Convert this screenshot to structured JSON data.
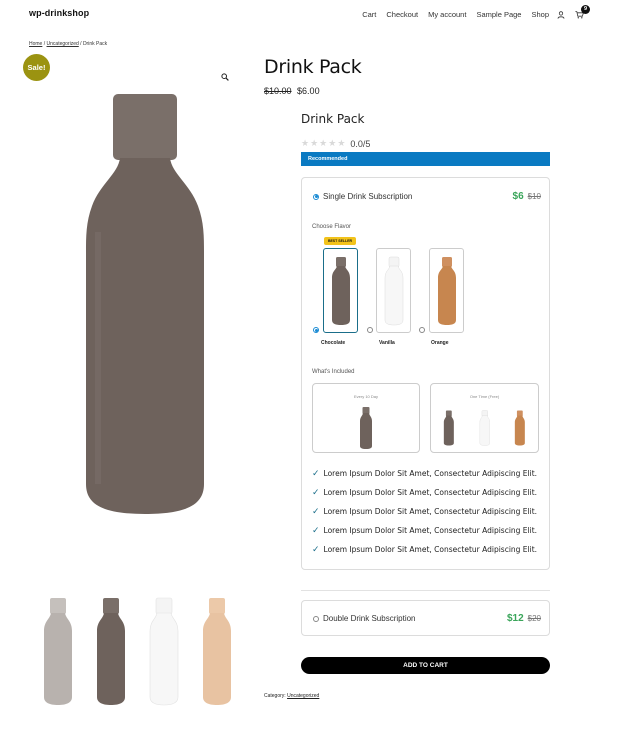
{
  "site": {
    "title": "wp-drinkshop"
  },
  "nav": {
    "items": [
      "Cart",
      "Checkout",
      "My account",
      "Sample Page",
      "Shop"
    ],
    "cart_count": "9"
  },
  "breadcrumb": {
    "home": "Home",
    "sep": " / ",
    "category": "Uncategorized",
    "current": "Drink Pack"
  },
  "gallery": {
    "sale_label": "Sale!"
  },
  "product": {
    "title": "Drink Pack",
    "old_price": "$10.00",
    "price": "$6.00",
    "sub_title": "Drink Pack",
    "rating": "0.0/5",
    "recommended": "Recommended"
  },
  "subscription": {
    "single": {
      "label": "Single Drink Subscription",
      "price": "$6",
      "old_price": "$10"
    },
    "double": {
      "label": "Double Drink Subscription",
      "price": "$12",
      "old_price": "$20"
    },
    "choose_flavor": "Choose Flavor",
    "best_seller": "BEST SELLER",
    "flavors": [
      {
        "name": "Chocolate",
        "selected": true,
        "color": "#6e625c"
      },
      {
        "name": "Vanilla",
        "selected": false,
        "color": "#f2f2f2"
      },
      {
        "name": "Orange",
        "selected": false,
        "color": "#c7864f"
      }
    ],
    "whats_included": "What's Included",
    "included": [
      {
        "label": "Every 10 Day"
      },
      {
        "label": "One Time (Free)"
      }
    ],
    "benefits": [
      "Lorem Ipsum Dolor Sit Amet, Consectetur Adipiscing Elit.",
      "Lorem Ipsum Dolor Sit Amet, Consectetur Adipiscing Elit.",
      "Lorem Ipsum Dolor Sit Amet, Consectetur Adipiscing Elit.",
      "Lorem Ipsum Dolor Sit Amet, Consectetur Adipiscing Elit.",
      "Lorem Ipsum Dolor Sit Amet, Consectetur Adipiscing Elit."
    ]
  },
  "cart": {
    "add_label": "ADD TO CART"
  },
  "meta": {
    "category_label": "Category:",
    "category": "Uncategorized"
  },
  "colors": {
    "sale": "#9b9311",
    "recommended": "#0a7ac2",
    "price_green": "#3aa55a",
    "bottle_chocolate": "#6e625c",
    "bottle_grey": "#b8b2ae",
    "bottle_vanilla": "#f2f2f2",
    "bottle_peach": "#e8c3a2",
    "bottle_orange": "#c7864f"
  },
  "icons": [
    "user-icon",
    "cart-icon",
    "search-zoom-icon",
    "star-icon",
    "check-icon"
  ]
}
